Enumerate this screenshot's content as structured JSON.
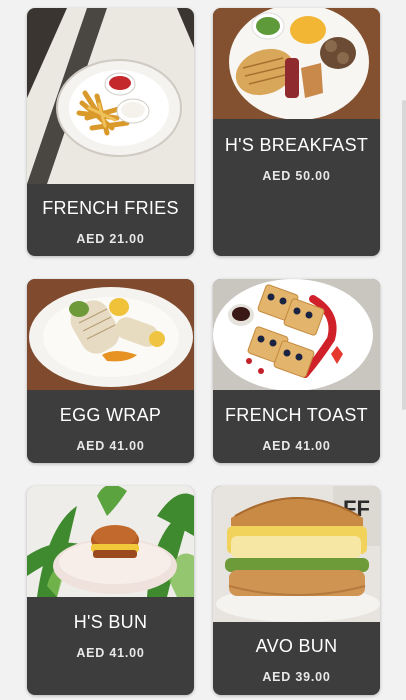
{
  "menu": {
    "items": [
      {
        "name": "FRENCH FRIES",
        "price": "AED 21.00",
        "image": "french-fries-photo"
      },
      {
        "name": "H'S BREAKFAST",
        "price": "AED 50.00",
        "image": "breakfast-plate-photo"
      },
      {
        "name": "EGG WRAP",
        "price": "AED 41.00",
        "image": "egg-wrap-photo"
      },
      {
        "name": "FRENCH TOAST",
        "price": "AED 41.00",
        "image": "french-toast-photo"
      },
      {
        "name": "H'S BUN",
        "price": "AED 41.00",
        "image": "hs-bun-photo"
      },
      {
        "name": "AVO BUN",
        "price": "AED 39.00",
        "image": "avo-bun-photo"
      }
    ]
  },
  "colors": {
    "card_background": "#3d3d3d",
    "page_background": "#f2f2f2",
    "text": "#ffffff"
  }
}
